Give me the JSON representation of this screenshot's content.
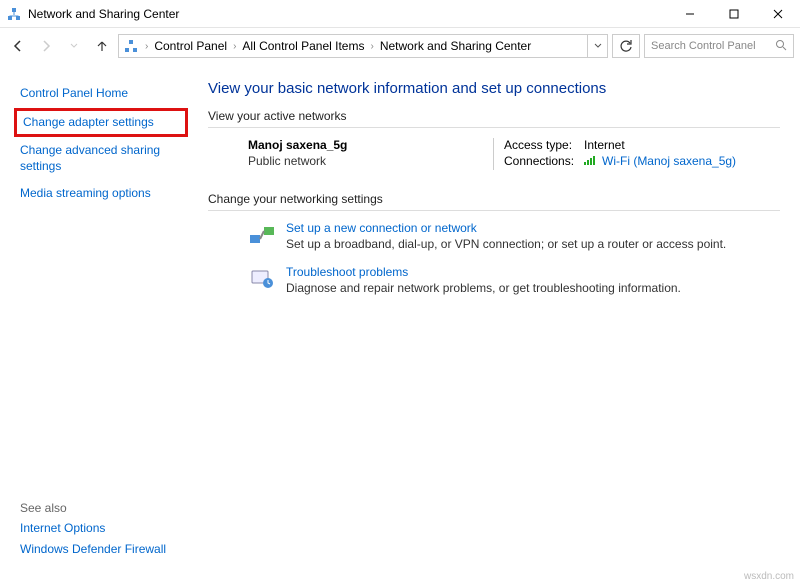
{
  "window": {
    "title": "Network and Sharing Center"
  },
  "breadcrumb": {
    "item1": "Control Panel",
    "item2": "All Control Panel Items",
    "item3": "Network and Sharing Center"
  },
  "search": {
    "placeholder": "Search Control Panel"
  },
  "sidebar": {
    "home": "Control Panel Home",
    "adapter": "Change adapter settings",
    "advanced": "Change advanced sharing settings",
    "media": "Media streaming options"
  },
  "seealso": {
    "heading": "See also",
    "internet": "Internet Options",
    "firewall": "Windows Defender Firewall"
  },
  "main": {
    "heading": "View your basic network information and set up connections",
    "active_label": "View your active networks",
    "network": {
      "name": "Manoj saxena_5g",
      "type": "Public network",
      "access_label": "Access type:",
      "access_value": "Internet",
      "conn_label": "Connections:",
      "conn_value": "Wi-Fi (Manoj saxena_5g)"
    },
    "change_label": "Change your networking settings",
    "setup": {
      "title": "Set up a new connection or network",
      "desc": "Set up a broadband, dial-up, or VPN connection; or set up a router or access point."
    },
    "troubleshoot": {
      "title": "Troubleshoot problems",
      "desc": "Diagnose and repair network problems, or get troubleshooting information."
    }
  },
  "watermark": "wsxdn.com"
}
